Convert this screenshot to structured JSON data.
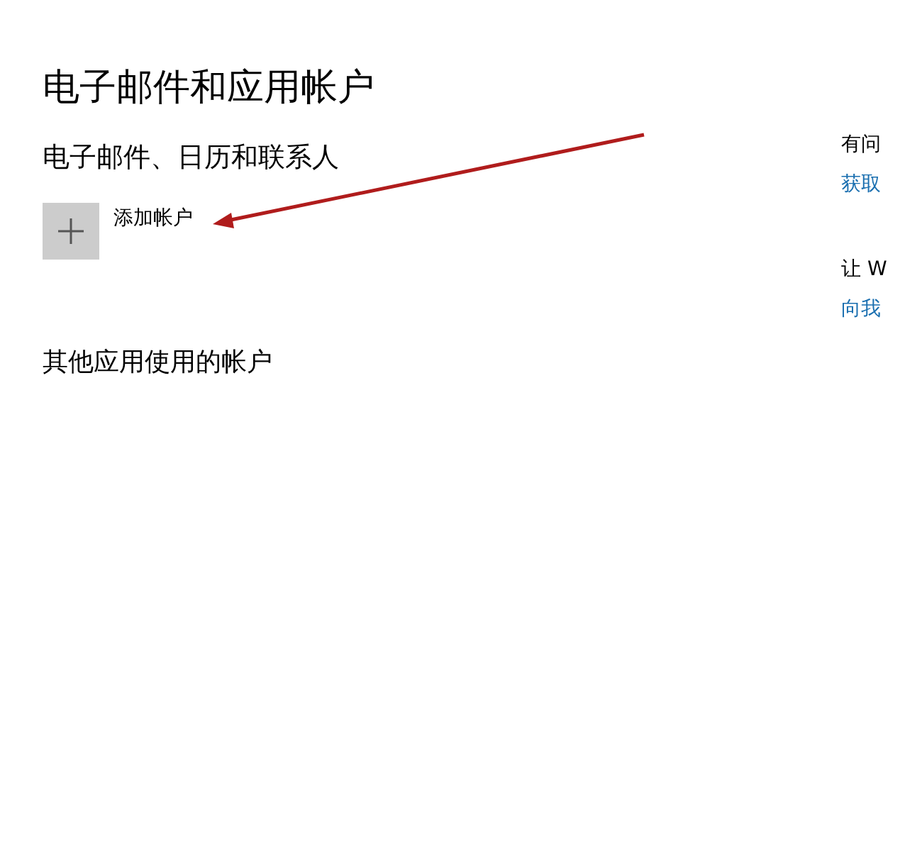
{
  "title": "电子邮件和应用帐户",
  "email_section": {
    "heading": "电子邮件、日历和联系人",
    "add_account": "添加帐户"
  },
  "other_section": {
    "heading": "其他应用使用的帐户"
  },
  "side": [
    {
      "text": "有问",
      "link": "获取"
    },
    {
      "text": "让 W",
      "link": "向我"
    }
  ]
}
